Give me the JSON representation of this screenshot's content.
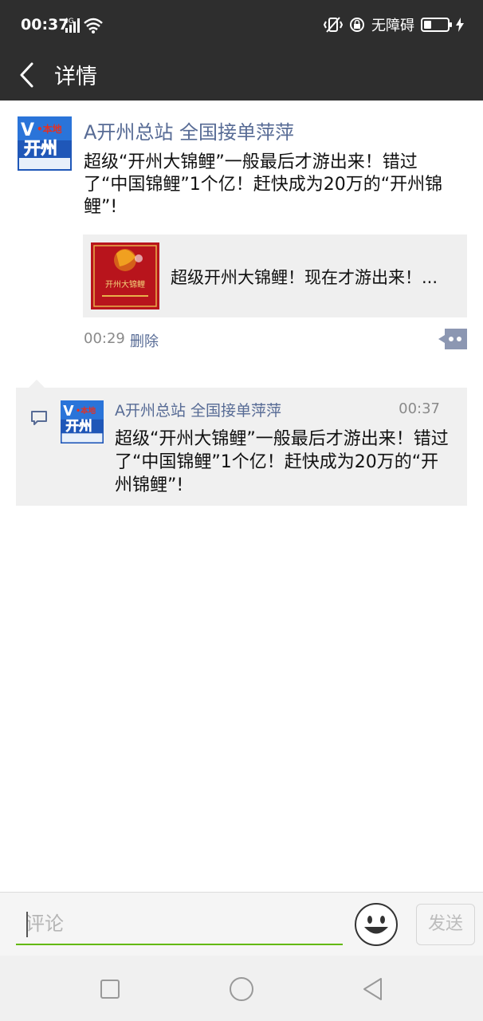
{
  "status_bar": {
    "time": "00:37",
    "network": "4G",
    "accessibility": "无障碍"
  },
  "header": {
    "title": "详情",
    "back_icon": "chevron-left-icon"
  },
  "post": {
    "author": "A开州总站 全国接单萍萍",
    "avatar_text_top": "V",
    "avatar_text_mid": "•本地",
    "avatar_text_main": "开州",
    "content": "超级“开州大锦鲤”一般最后才游出来！错过了“中国锦鲤”1个亿！赶快成为20万的“开州锦鲤”!",
    "link": {
      "title": "超级开州大锦鲤！现在才游出来！...",
      "thumb_text": "开州大锦鲤"
    },
    "time": "00:29",
    "delete_label": "删除"
  },
  "comments": [
    {
      "author": "A开州总站 全国接单萍萍",
      "time": "00:37",
      "text": "超级“开州大锦鲤”一般最后才游出来！错过了“中国锦鲤”1个亿！赶快成为20万的“开州锦鲤”!"
    }
  ],
  "input_bar": {
    "placeholder": "评论",
    "send_label": "发送"
  },
  "colors": {
    "header_bg": "#2e2e2e",
    "link_blue": "#576b95",
    "accent_green": "#62b900"
  }
}
